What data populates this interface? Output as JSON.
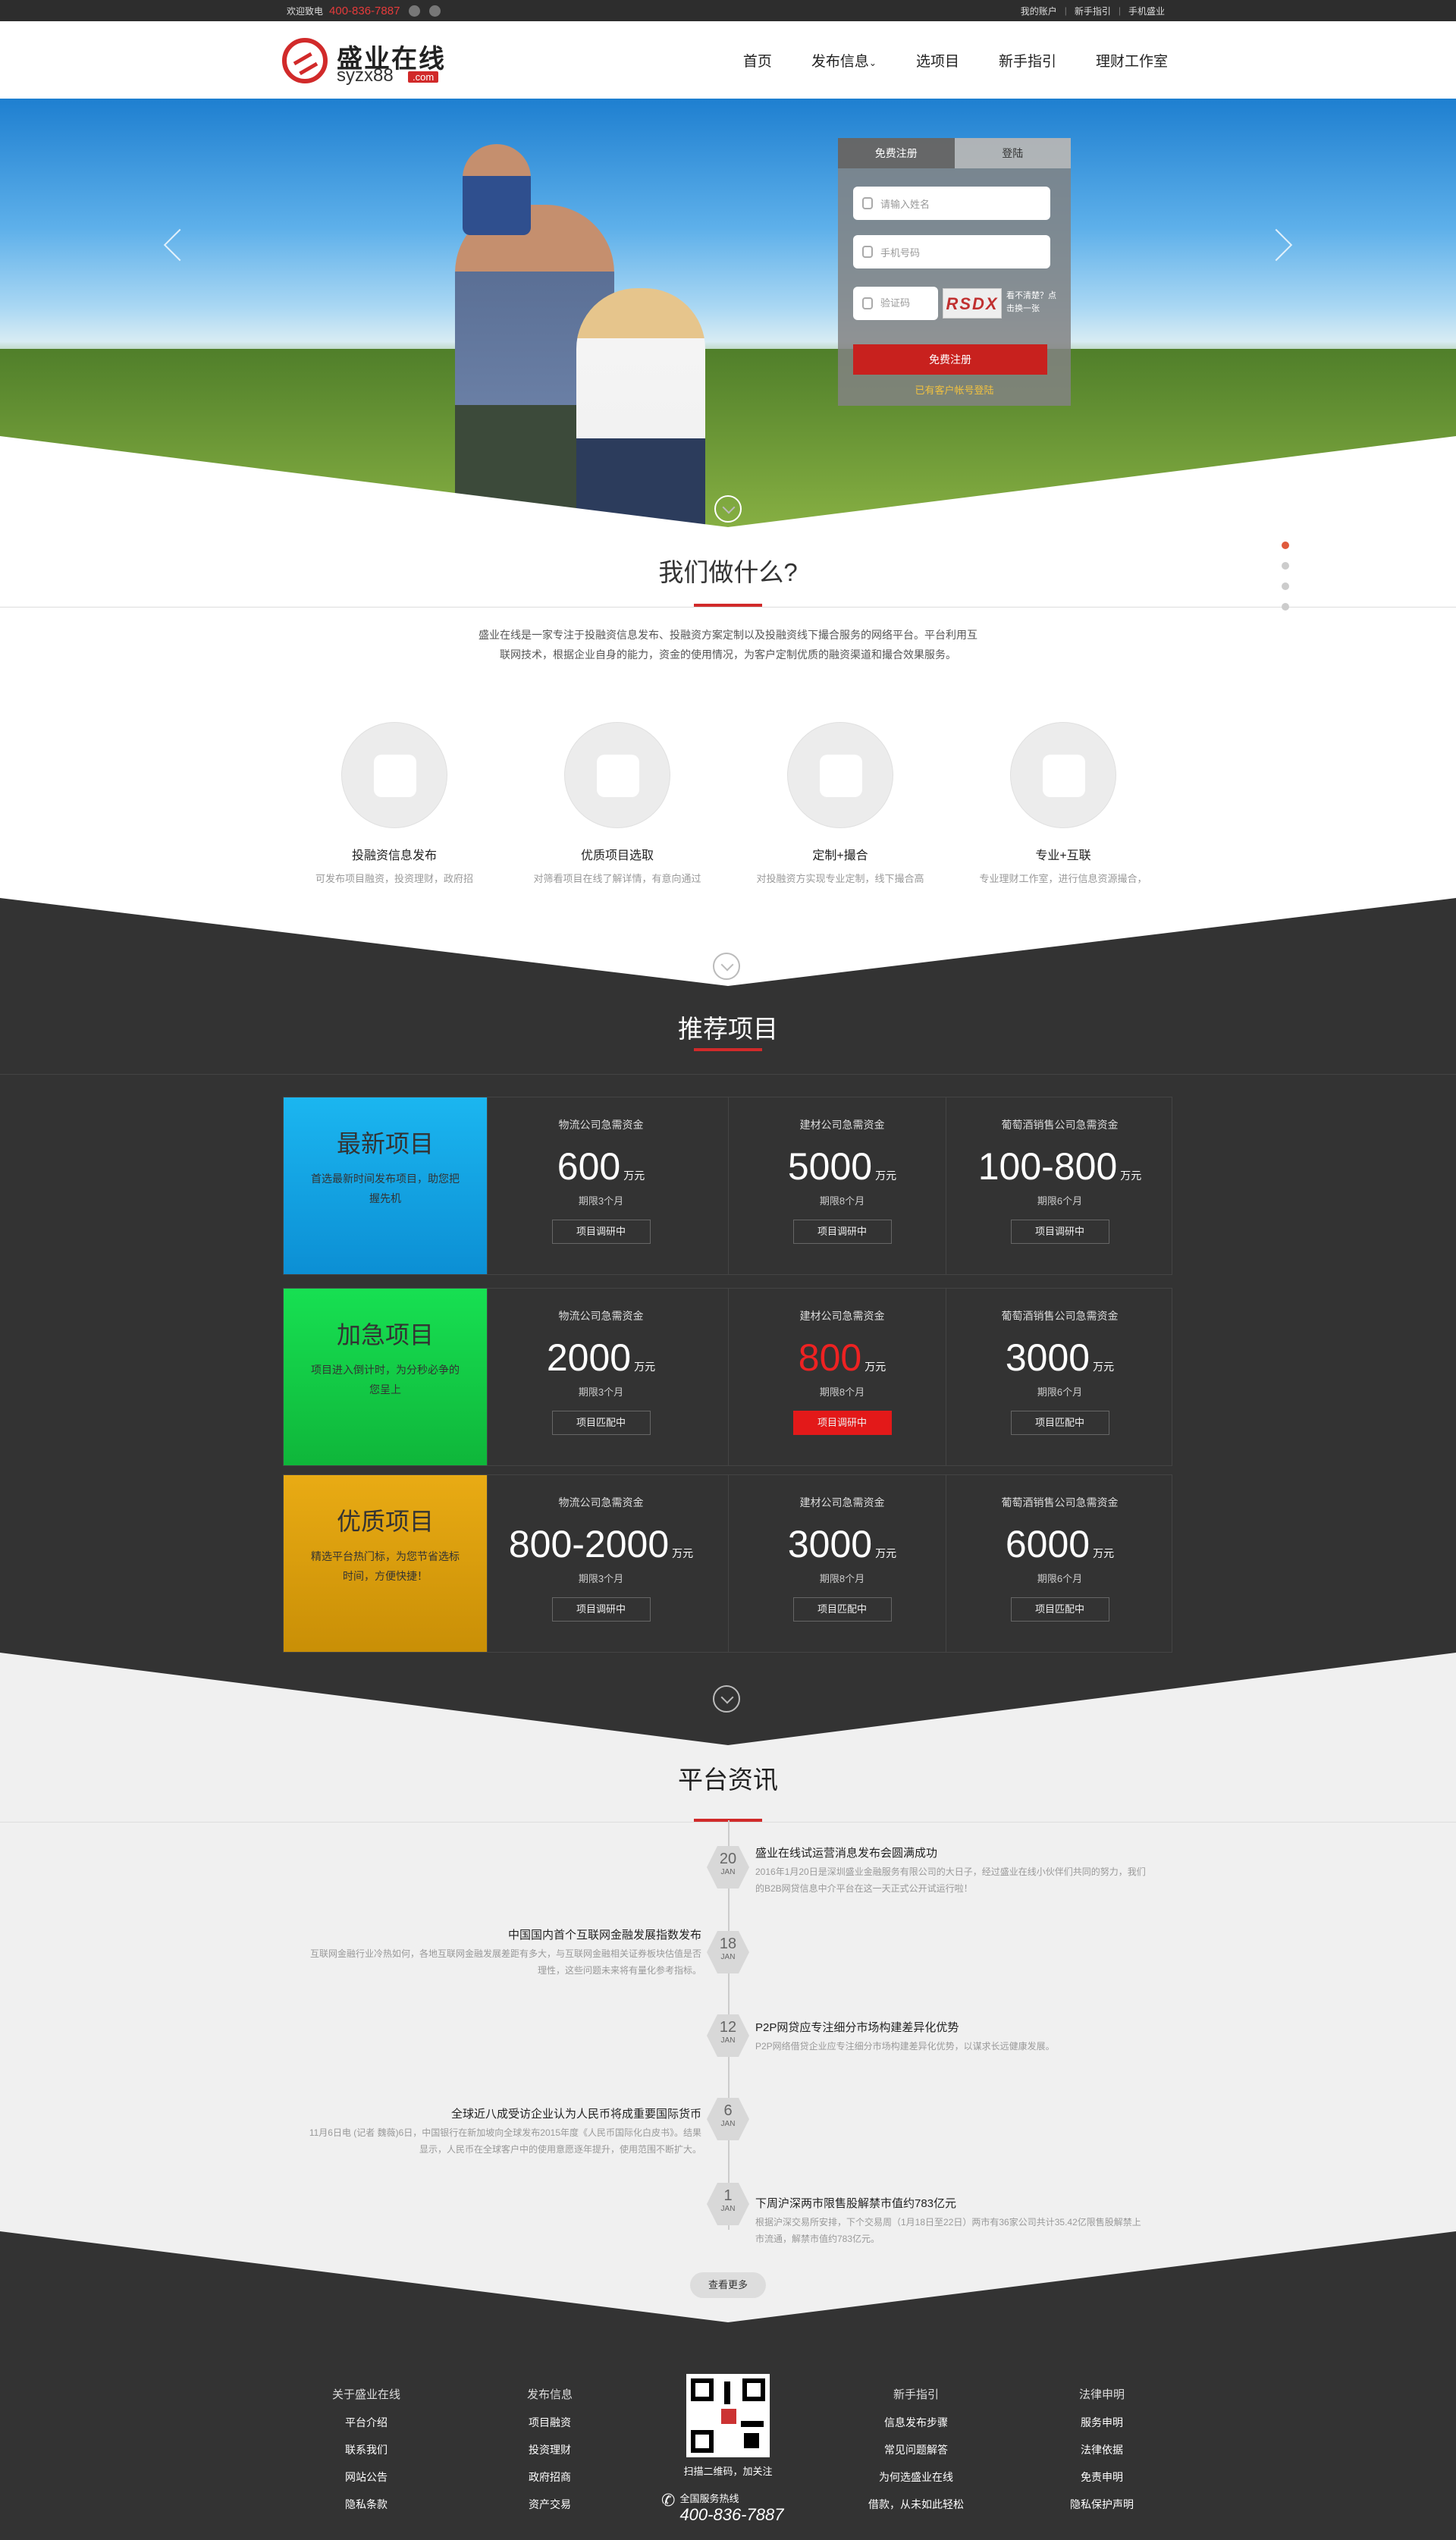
{
  "topbar": {
    "welcome": "欢迎致电",
    "phone": "400-836-7887",
    "links": [
      "我的账户",
      "新手指引",
      "手机盛业"
    ]
  },
  "logo": {
    "cn": "盛业在线",
    "en": "syzx88",
    "com": ".com"
  },
  "nav": [
    "首页",
    "发布信息",
    "选项目",
    "新手指引",
    "理财工作室"
  ],
  "register": {
    "tab_register": "免费注册",
    "tab_login": "登陆",
    "name_ph": "请输入姓名",
    "phone_ph": "手机号码",
    "code_ph": "验证码",
    "captcha": "RSDX",
    "captcha_tip": "看不清楚？点击换一张",
    "submit": "免费注册",
    "login_link": "已有客户帐号登陆"
  },
  "what": {
    "title": "我们做什么?",
    "intro": "盛业在线是一家专注于投融资信息发布、投融资方案定制以及投融资线下撮合服务的网络平台。平台利用互联网技术，根据企业自身的能力，资金的使用情况，为客户定制优质的融资渠道和撮合效果服务。",
    "services": [
      {
        "title": "投融资信息发布",
        "desc": "可发布项目融资，投资理财，政府招商，资产交易等类别"
      },
      {
        "title": "优质项目选取",
        "desc": "对筛看项目在线了解详情，有意向通过多种方式告之我们"
      },
      {
        "title": "定制+撮合",
        "desc": "对投融资方实现专业定制，线下撮合高效、便捷"
      },
      {
        "title": "专业+互联",
        "desc": "专业理财工作室，进行信息资源撮合，提供资金匹配方案"
      }
    ]
  },
  "projects": {
    "title": "推荐项目",
    "unit": "万元",
    "rows": [
      {
        "name": "最新项目",
        "desc": "首选最新时间发布项目，助您把握先机",
        "color": "#18a9e6",
        "cells": [
          {
            "name": "物流公司急需资金",
            "value": "600",
            "period": "期限3个月",
            "status": "项目调研中",
            "hl": false
          },
          {
            "name": "建材公司急需资金",
            "value": "5000",
            "period": "期限8个月",
            "status": "项目调研中",
            "hl": false
          },
          {
            "name": "葡萄酒销售公司急需资金",
            "value": "100-800",
            "period": "期限6个月",
            "status": "项目调研中",
            "hl": false
          }
        ]
      },
      {
        "name": "加急项目",
        "desc": "项目进入倒计时，为分秒必争的您呈上",
        "color": "#17d34d",
        "cells": [
          {
            "name": "物流公司急需资金",
            "value": "2000",
            "period": "期限3个月",
            "status": "项目匹配中",
            "hl": false
          },
          {
            "name": "建材公司急需资金",
            "value": "800",
            "period": "期限8个月",
            "status": "项目调研中",
            "hl": true
          },
          {
            "name": "葡萄酒销售公司急需资金",
            "value": "3000",
            "period": "期限6个月",
            "status": "项目匹配中",
            "hl": false
          }
        ]
      },
      {
        "name": "优质项目",
        "desc": "精选平台热门标，为您节省选标时间，方便快捷！",
        "color": "#e0a413",
        "cells": [
          {
            "name": "物流公司急需资金",
            "value": "800-2000",
            "period": "期限3个月",
            "status": "项目调研中",
            "hl": false
          },
          {
            "name": "建材公司急需资金",
            "value": "3000",
            "period": "期限8个月",
            "status": "项目匹配中",
            "hl": false
          },
          {
            "name": "葡萄酒销售公司急需资金",
            "value": "6000",
            "period": "期限6个月",
            "status": "项目匹配中",
            "hl": false
          }
        ]
      }
    ]
  },
  "news": {
    "title": "平台资讯",
    "more": "查看更多",
    "items": [
      {
        "day": "20",
        "mon": "JAN",
        "title": "盛业在线试运营消息发布会圆满成功",
        "desc": "2016年1月20日是深圳盛业金融服务有限公司的大日子，经过盛业在线小伙伴们共同的努力，我们的B2B网贷信息中介平台在这一天正式公开试运行啦！",
        "side": "right"
      },
      {
        "day": "18",
        "mon": "JAN",
        "title": "中国国内首个互联网金融发展指数发布",
        "desc": "互联网金融行业冷热如何，各地互联网金融发展差距有多大，与互联网金融相关证券板块估值是否理性，这些问题未来将有量化参考指标。",
        "side": "left"
      },
      {
        "day": "12",
        "mon": "JAN",
        "title": "P2P网贷应专注细分市场构建差异化优势",
        "desc": "P2P网络借贷企业应专注细分市场构建差异化优势，以谋求长远健康发展。",
        "side": "right"
      },
      {
        "day": "6",
        "mon": "JAN",
        "title": "全球近八成受访企业认为人民币将成重要国际货币",
        "desc": "11月6日电 (记者 魏薇)6日，中国银行在新加坡向全球发布2015年度《人民币国际化白皮书》。结果显示，人民币在全球客户中的使用意愿逐年提升，使用范围不断扩大。",
        "side": "left"
      },
      {
        "day": "1",
        "mon": "JAN",
        "title": "下周沪深两市限售股解禁市值约783亿元",
        "desc": "根据沪深交易所安排，下个交易周（1月18日至22日）两市有36家公司共计35.42亿限售股解禁上市流通，解禁市值约783亿元。",
        "side": "right"
      }
    ]
  },
  "footer": {
    "cols": [
      {
        "head": "关于盛业在线",
        "items": [
          "平台介绍",
          "联系我们",
          "网站公告",
          "隐私条款"
        ]
      },
      {
        "head": "发布信息",
        "items": [
          "项目融资",
          "投资理财",
          "政府招商",
          "资产交易"
        ]
      },
      {
        "head": "新手指引",
        "items": [
          "信息发布步骤",
          "常见问题解答",
          "为何选盛业在线",
          "借款，从未如此轻松"
        ]
      },
      {
        "head": "法律申明",
        "items": [
          "服务申明",
          "法律依据",
          "免责申明",
          "隐私保护声明"
        ]
      }
    ],
    "qr_text": "扫描二维码，加关注",
    "hotline_label": "全国服务热线",
    "hotline": "400-836-7887"
  }
}
